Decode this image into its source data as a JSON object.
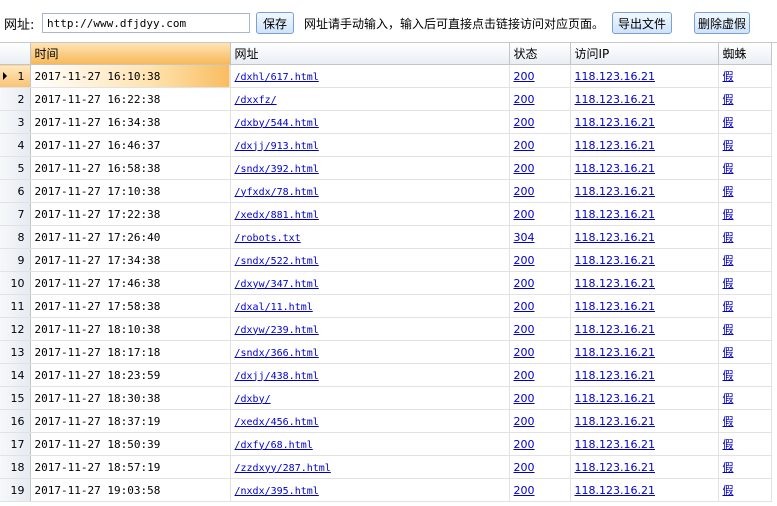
{
  "toolbar": {
    "url_label": "网址:",
    "url_value": "http://www.dfjdyy.com",
    "save_label": "保存",
    "hint": "网址请手动输入，输入后可直接点击链接访问对应页面。",
    "export_label": "导出文件",
    "delete_label": "删除虚假"
  },
  "columns": {
    "time": "时间",
    "url": "网址",
    "status": "状态",
    "ip": "访问IP",
    "spider": "蜘蛛"
  },
  "rows": [
    {
      "n": "1",
      "time": "2017-11-27 16:10:38",
      "url": "/dxhl/617.html",
      "status": "200",
      "ip": "118.123.16.21",
      "spider": "假"
    },
    {
      "n": "2",
      "time": "2017-11-27 16:22:38",
      "url": "/dxxfz/",
      "status": "200",
      "ip": "118.123.16.21",
      "spider": "假"
    },
    {
      "n": "3",
      "time": "2017-11-27 16:34:38",
      "url": "/dxby/544.html",
      "status": "200",
      "ip": "118.123.16.21",
      "spider": "假"
    },
    {
      "n": "4",
      "time": "2017-11-27 16:46:37",
      "url": "/dxjj/913.html",
      "status": "200",
      "ip": "118.123.16.21",
      "spider": "假"
    },
    {
      "n": "5",
      "time": "2017-11-27 16:58:38",
      "url": "/sndx/392.html",
      "status": "200",
      "ip": "118.123.16.21",
      "spider": "假"
    },
    {
      "n": "6",
      "time": "2017-11-27 17:10:38",
      "url": "/yfxdx/78.html",
      "status": "200",
      "ip": "118.123.16.21",
      "spider": "假"
    },
    {
      "n": "7",
      "time": "2017-11-27 17:22:38",
      "url": "/xedx/881.html",
      "status": "200",
      "ip": "118.123.16.21",
      "spider": "假"
    },
    {
      "n": "8",
      "time": "2017-11-27 17:26:40",
      "url": "/robots.txt",
      "status": "304",
      "ip": "118.123.16.21",
      "spider": "假"
    },
    {
      "n": "9",
      "time": "2017-11-27 17:34:38",
      "url": "/sndx/522.html",
      "status": "200",
      "ip": "118.123.16.21",
      "spider": "假"
    },
    {
      "n": "10",
      "time": "2017-11-27 17:46:38",
      "url": "/dxyw/347.html",
      "status": "200",
      "ip": "118.123.16.21",
      "spider": "假"
    },
    {
      "n": "11",
      "time": "2017-11-27 17:58:38",
      "url": "/dxal/11.html",
      "status": "200",
      "ip": "118.123.16.21",
      "spider": "假"
    },
    {
      "n": "12",
      "time": "2017-11-27 18:10:38",
      "url": "/dxyw/239.html",
      "status": "200",
      "ip": "118.123.16.21",
      "spider": "假"
    },
    {
      "n": "13",
      "time": "2017-11-27 18:17:18",
      "url": "/sndx/366.html",
      "status": "200",
      "ip": "118.123.16.21",
      "spider": "假"
    },
    {
      "n": "14",
      "time": "2017-11-27 18:23:59",
      "url": "/dxjj/438.html",
      "status": "200",
      "ip": "118.123.16.21",
      "spider": "假"
    },
    {
      "n": "15",
      "time": "2017-11-27 18:30:38",
      "url": "/dxby/",
      "status": "200",
      "ip": "118.123.16.21",
      "spider": "假"
    },
    {
      "n": "16",
      "time": "2017-11-27 18:37:19",
      "url": "/xedx/456.html",
      "status": "200",
      "ip": "118.123.16.21",
      "spider": "假"
    },
    {
      "n": "17",
      "time": "2017-11-27 18:50:39",
      "url": "/dxfy/68.html",
      "status": "200",
      "ip": "118.123.16.21",
      "spider": "假"
    },
    {
      "n": "18",
      "time": "2017-11-27 18:57:19",
      "url": "/zzdxyy/287.html",
      "status": "200",
      "ip": "118.123.16.21",
      "spider": "假"
    },
    {
      "n": "19",
      "time": "2017-11-27 19:03:58",
      "url": "/nxdx/395.html",
      "status": "200",
      "ip": "118.123.16.21",
      "spider": "假"
    }
  ]
}
